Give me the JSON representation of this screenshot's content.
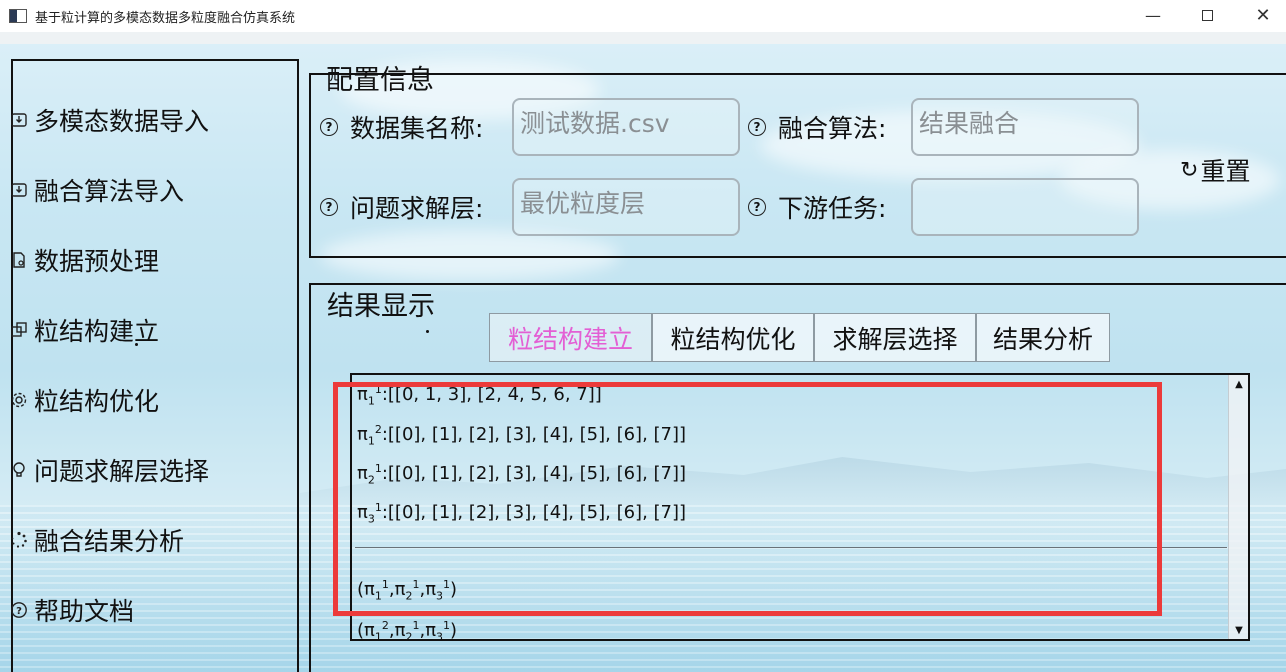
{
  "window": {
    "title": "基于粒计算的多模态数据多粒度融合仿真系统",
    "minimize_glyph": "—",
    "close_glyph": "✕"
  },
  "sidebar": {
    "items": [
      {
        "label": "多模态数据导入",
        "icon": "import-icon"
      },
      {
        "label": "融合算法导入",
        "icon": "import-icon"
      },
      {
        "label": "数据预处理",
        "icon": "file-settings-icon"
      },
      {
        "label": "粒结构建立",
        "icon": "copy-icon"
      },
      {
        "label": "粒结构优化",
        "icon": "gear-icon"
      },
      {
        "label": "问题求解层选择",
        "icon": "lightbulb-icon"
      },
      {
        "label": "融合结果分析",
        "icon": "loading-icon"
      },
      {
        "label": "帮助文档",
        "icon": "help-icon"
      }
    ]
  },
  "config": {
    "title": "配置信息",
    "fields": {
      "dataset_name": {
        "label": "数据集名称:",
        "value": "测试数据.csv"
      },
      "fusion_algorithm": {
        "label": "融合算法:",
        "value": "结果融合"
      },
      "solving_layer": {
        "label": "问题求解层:",
        "value": "最优粒度层"
      },
      "downstream_task": {
        "label": "下游任务:",
        "value": ""
      }
    },
    "reset_label": "重置",
    "reset_icon": "refresh-icon",
    "help_glyph": "?"
  },
  "results": {
    "title": "结果显示",
    "tabs": [
      "粒结构建立",
      "粒结构优化",
      "求解层选择",
      "结果分析"
    ],
    "active_tab": 0,
    "lines": [
      {
        "base": "π",
        "sub": "1",
        "sup": "1",
        "text": ":[[0, 1, 3], [2, 4, 5, 6, 7]]"
      },
      {
        "base": "π",
        "sub": "1",
        "sup": "2",
        "text": ":[[0], [1], [2], [3], [4], [5], [6], [7]]"
      },
      {
        "base": "π",
        "sub": "2",
        "sup": "1",
        "text": ":[[0], [1], [2], [3], [4], [5], [6], [7]]"
      },
      {
        "base": "π",
        "sub": "3",
        "sup": "1",
        "text": ":[[0], [1], [2], [3], [4], [5], [6], [7]]"
      }
    ],
    "combos": [
      {
        "parts": [
          {
            "sub": "1",
            "sup": "1"
          },
          {
            "sub": "2",
            "sup": "1"
          },
          {
            "sub": "3",
            "sup": "1"
          }
        ]
      },
      {
        "parts": [
          {
            "sub": "1",
            "sup": "2"
          },
          {
            "sub": "2",
            "sup": "1"
          },
          {
            "sub": "3",
            "sup": "1"
          }
        ]
      }
    ],
    "scroll_up_glyph": "▲",
    "scroll_down_glyph": "▼"
  },
  "colors": {
    "active_tab": "#e35fd4",
    "highlight_border": "#ec3a3a"
  }
}
